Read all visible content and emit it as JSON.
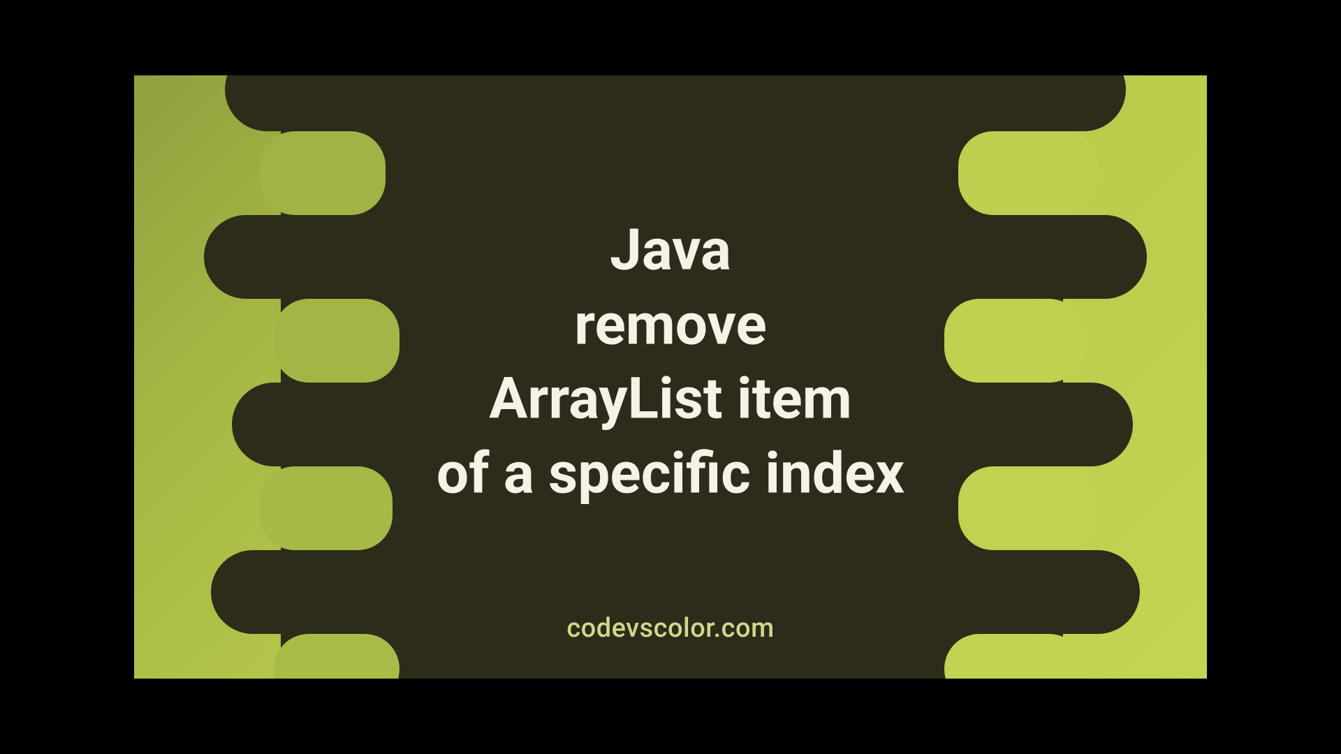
{
  "title": {
    "line1": "Java",
    "line2": "remove",
    "line3": "ArrayList item",
    "line4": "of a specific index"
  },
  "watermark": "codevscolor.com",
  "colors": {
    "background_dark": "#2d2b1a",
    "background_olive_start": "#8fa03e",
    "background_olive_end": "#c5d452",
    "title_text": "#f5f3e8",
    "watermark_text": "#d0d88a"
  }
}
